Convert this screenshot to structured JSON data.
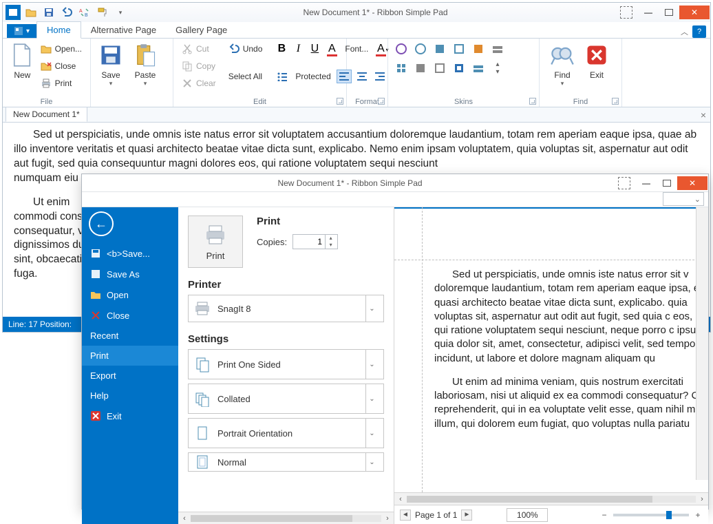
{
  "main": {
    "title": "New Document 1* - Ribbon Simple Pad",
    "tabs": {
      "file": "",
      "home": "Home",
      "alt": "Alternative Page",
      "gallery": "Gallery Page"
    },
    "groups": {
      "file": "File",
      "edit": "Edit",
      "format": "Format",
      "skins": "Skins",
      "find": "Find"
    },
    "file_btns": {
      "new": "New",
      "open": "Open...",
      "close": "Close",
      "print": "Print",
      "save": "Save",
      "paste": "Paste"
    },
    "edit_btns": {
      "cut": "Cut",
      "copy": "Copy",
      "clear": "Clear",
      "undo": "Undo",
      "selectall": "Select All",
      "protected": "Protected"
    },
    "format_btns": {
      "font": "Font..."
    },
    "find_btns": {
      "find": "Find",
      "exit": "Exit"
    },
    "doc_tab": "New Document 1*",
    "body_p1": "Sed ut perspiciatis, unde omnis iste natus error sit voluptatem accusantium doloremque laudantium, totam rem aperiam eaque ipsa, quae ab illo inventore veritatis et quasi architecto beatae vitae dicta sunt, explicabo. Nemo enim ipsam voluptatem, quia voluptas sit, aspernatur aut odit aut fugit, sed quia consequuntur magni dolores eos, qui ratione voluptatem sequi nesciunt",
    "body_p2": "numquam eiu",
    "body_p3": "Ut enim",
    "body_p4": "commodi cons",
    "body_p5": "consequatur, v",
    "body_p6": "dignissimos du",
    "body_p7": "sint, obcaecati",
    "body_p8": "fuga.",
    "status": "Line: 17 Position:"
  },
  "print": {
    "title": "New Document 1* - Ribbon Simple Pad",
    "backstage": {
      "save": "<b>Save...",
      "saveas": "Save As",
      "open": "Open",
      "close": "Close",
      "recent": "Recent",
      "print": "Print",
      "export": "Export",
      "help": "Help",
      "exit": "Exit"
    },
    "panel": {
      "print_label": "Print",
      "print_heading": "Print",
      "copies_label": "Copies:",
      "copies_value": "1",
      "printer_heading": "Printer",
      "printer_name": "SnagIt 8",
      "settings_heading": "Settings",
      "one_sided": "Print One Sided",
      "collated": "Collated",
      "portrait": "Portrait Orientation",
      "normal": "Normal"
    },
    "preview": {
      "p1": "Sed ut perspiciatis, unde omnis iste natus error sit v doloremque laudantium, totam rem aperiam eaque ipsa, et quasi architecto beatae vitae dicta sunt, explicabo. quia voluptas sit, aspernatur aut odit aut fugit, sed quia c eos, qui ratione voluptatem sequi nesciunt, neque porro c ipsum, quia dolor sit, amet, consectetur,  adipisci velit, sed tempora incidunt, ut labore et dolore magnam aliquam qu",
      "p2": "Ut enim ad minima veniam, quis nostrum exercitati laboriosam, nisi ut aliquid ex ea commodi consequatur? C reprehenderit, qui in ea voluptate velit esse, quam nihil m illum, qui dolorem eum fugiat, quo voluptas nulla pariatu",
      "page": "Page 1 of 1",
      "zoom": "100%"
    }
  }
}
